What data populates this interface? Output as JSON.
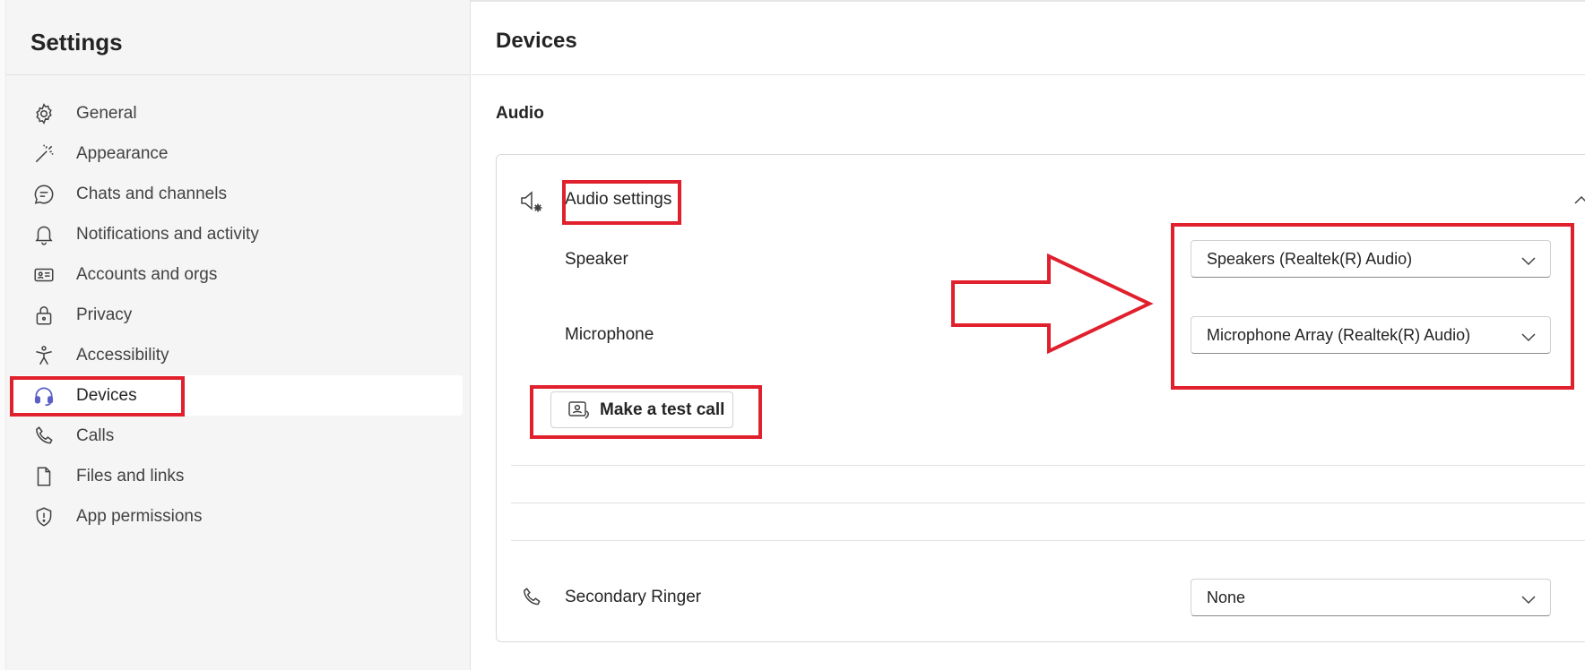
{
  "sidebar": {
    "title": "Settings",
    "items": [
      {
        "label": "General",
        "icon": "gear-icon"
      },
      {
        "label": "Appearance",
        "icon": "magic-wand-icon"
      },
      {
        "label": "Chats and channels",
        "icon": "chat-icon"
      },
      {
        "label": "Notifications and activity",
        "icon": "bell-icon"
      },
      {
        "label": "Accounts and orgs",
        "icon": "id-card-icon"
      },
      {
        "label": "Privacy",
        "icon": "lock-icon"
      },
      {
        "label": "Accessibility",
        "icon": "accessibility-icon"
      },
      {
        "label": "Devices",
        "icon": "headset-icon",
        "active": true
      },
      {
        "label": "Calls",
        "icon": "phone-icon"
      },
      {
        "label": "Files and links",
        "icon": "document-icon"
      },
      {
        "label": "App permissions",
        "icon": "shield-icon"
      }
    ]
  },
  "main": {
    "title": "Devices",
    "section": "Audio",
    "audio_settings": {
      "label": "Audio settings",
      "speaker": {
        "label": "Speaker",
        "value": "Speakers (Realtek(R) Audio)"
      },
      "microphone": {
        "label": "Microphone",
        "value": "Microphone Array (Realtek(R) Audio)"
      },
      "test_call_label": "Make a test call"
    },
    "secondary_ringer": {
      "label": "Secondary Ringer",
      "value": "None"
    }
  },
  "colors": {
    "annotation": "#e0202c",
    "accent": "#5b5fc7",
    "sidebar_bg": "#f5f5f5"
  }
}
